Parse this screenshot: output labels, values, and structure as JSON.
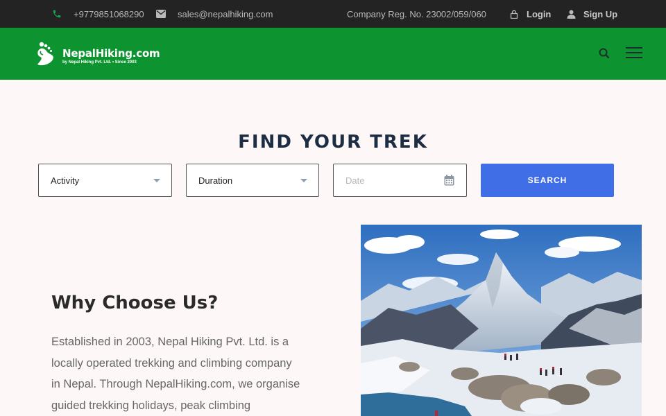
{
  "topbar": {
    "phone": "+9779851068290",
    "email": "sales@nepalhiking.com",
    "company_reg": "Company Reg. No. 23002/059/060",
    "login_label": "Login",
    "signup_label": "Sign Up",
    "icons": {
      "phone": "phone-icon",
      "email": "envelope-icon",
      "login": "lock-icon",
      "signup": "user-icon"
    },
    "accent_color": "#16a34a"
  },
  "header": {
    "logo_name": "NepalHiking.com",
    "logo_tagline": "by Nepal Hiking Pvt. Ltd. • Since 2003",
    "bg_color": "#0d9430",
    "icons": {
      "search": "search-icon",
      "menu": "hamburger-menu-icon"
    }
  },
  "finder": {
    "title": "FIND YOUR TREK",
    "activity_selected": "Activity",
    "duration_selected": "Duration",
    "date_placeholder": "Date",
    "search_label": "SEARCH",
    "button_color": "#3f6ee6"
  },
  "why": {
    "title": "Why Choose Us?",
    "lines": [
      "Established in 2003, Nepal Hiking Pvt. Ltd. is a",
      "locally operated trekking and climbing company",
      "in Nepal. Through NepalHiking.com, we organise",
      "guided trekking holidays, peak climbing"
    ]
  }
}
